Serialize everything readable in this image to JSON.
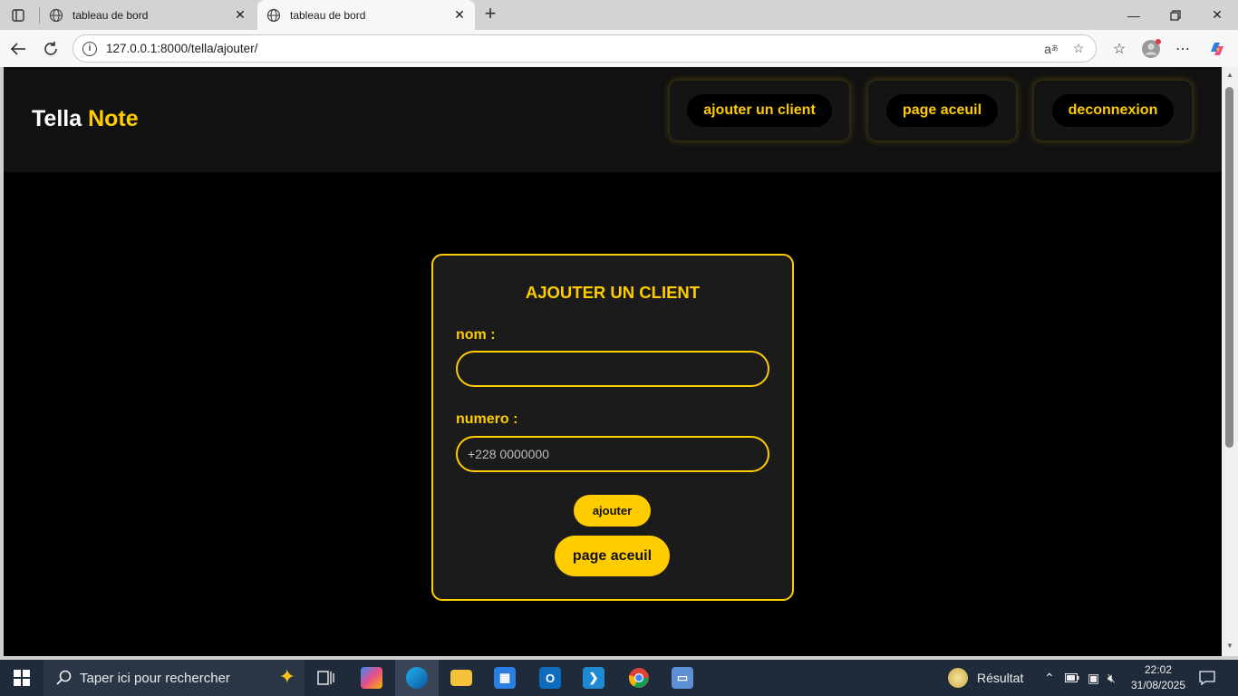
{
  "browser": {
    "tabs": [
      {
        "title": "tableau de bord"
      },
      {
        "title": "tableau de bord"
      }
    ],
    "url": "127.0.0.1:8000/tella/ajouter/"
  },
  "site": {
    "logo_primary": "Tella",
    "logo_accent": "Note",
    "nav": [
      "ajouter un client",
      "page aceuil",
      "deconnexion"
    ]
  },
  "form": {
    "title": "AJOUTER UN CLIENT",
    "nom_label": "nom :",
    "nom_value": "",
    "numero_label": "numero :",
    "numero_placeholder": "+228 0000000",
    "submit_label": "ajouter",
    "home_label": "page aceuil"
  },
  "taskbar": {
    "search_placeholder": "Taper ici pour rechercher",
    "weather_label": "Résultat",
    "time": "22:02",
    "date": "31/08/2025"
  },
  "colors": {
    "accent": "#ffcc00",
    "page_bg": "#000000",
    "card_bg": "#1b1b1b"
  }
}
